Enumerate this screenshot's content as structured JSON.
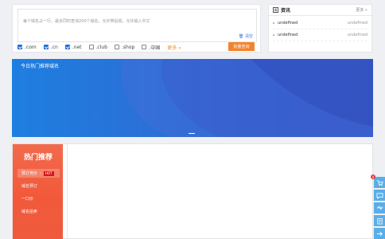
{
  "search": {
    "placeholder": "每个域名占一行，最多同时查询200个域名，允许带后缀，允许输入中文",
    "clear_label": "清空",
    "tlds": [
      {
        "label": ".com",
        "checked": true
      },
      {
        "label": ".cn",
        "checked": true
      },
      {
        "label": ".net",
        "checked": true
      },
      {
        "label": ".club",
        "checked": false
      },
      {
        "label": ".shop",
        "checked": false
      },
      {
        "label": ".中国",
        "checked": false
      }
    ],
    "more_label": "更多 »",
    "batch_button": "批量查询"
  },
  "news": {
    "title": "资讯",
    "more_label": "更多 »",
    "items": [
      {
        "title": "undefined",
        "date": "undefined"
      },
      {
        "title": "undefined",
        "date": "undefined"
      }
    ]
  },
  "banner": {
    "title": "今日热门推荐域名"
  },
  "hot": {
    "title": "热门推荐",
    "tabs": [
      {
        "label": "预订竞价",
        "badge": "HOT",
        "active": true
      },
      {
        "label": "域名预订",
        "active": false
      },
      {
        "label": "一口价",
        "active": false
      },
      {
        "label": "域名拍卖",
        "active": false
      }
    ]
  },
  "float_bar": {
    "badge_count": "0",
    "icons": [
      "cart-icon",
      "chat-icon",
      "handshake-icon",
      "clipboard-icon",
      "arrow-right-icon"
    ]
  },
  "colors": {
    "accent": "#f4842c",
    "banner_blue": "#2b6fd7",
    "hot_red": "#f2593a",
    "float_blue": "#5aaee8"
  }
}
